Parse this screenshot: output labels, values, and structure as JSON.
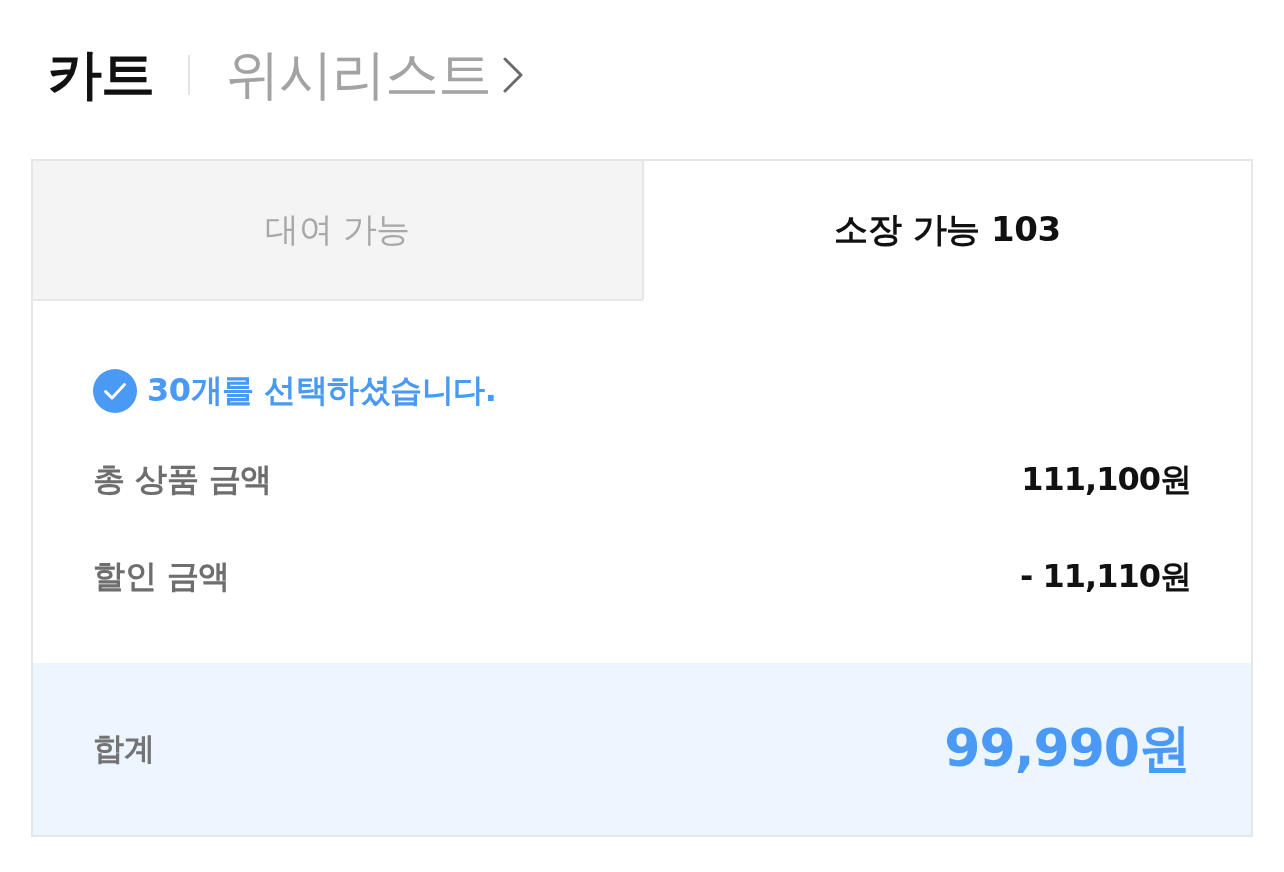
{
  "header": {
    "title": "카트",
    "wishlist_link": "위시리스트"
  },
  "tabs": [
    {
      "label": "대여 가능",
      "selected": false
    },
    {
      "label": "소장 가능 103",
      "selected": true
    }
  ],
  "selection_notice": "30개를 선택하셨습니다.",
  "summary_rows": [
    {
      "label": "총 상품 금액",
      "value": "111,100원"
    },
    {
      "label": "할인 금액",
      "value": "- 11,110원"
    }
  ],
  "total": {
    "label": "합계",
    "value": "99,990원"
  }
}
